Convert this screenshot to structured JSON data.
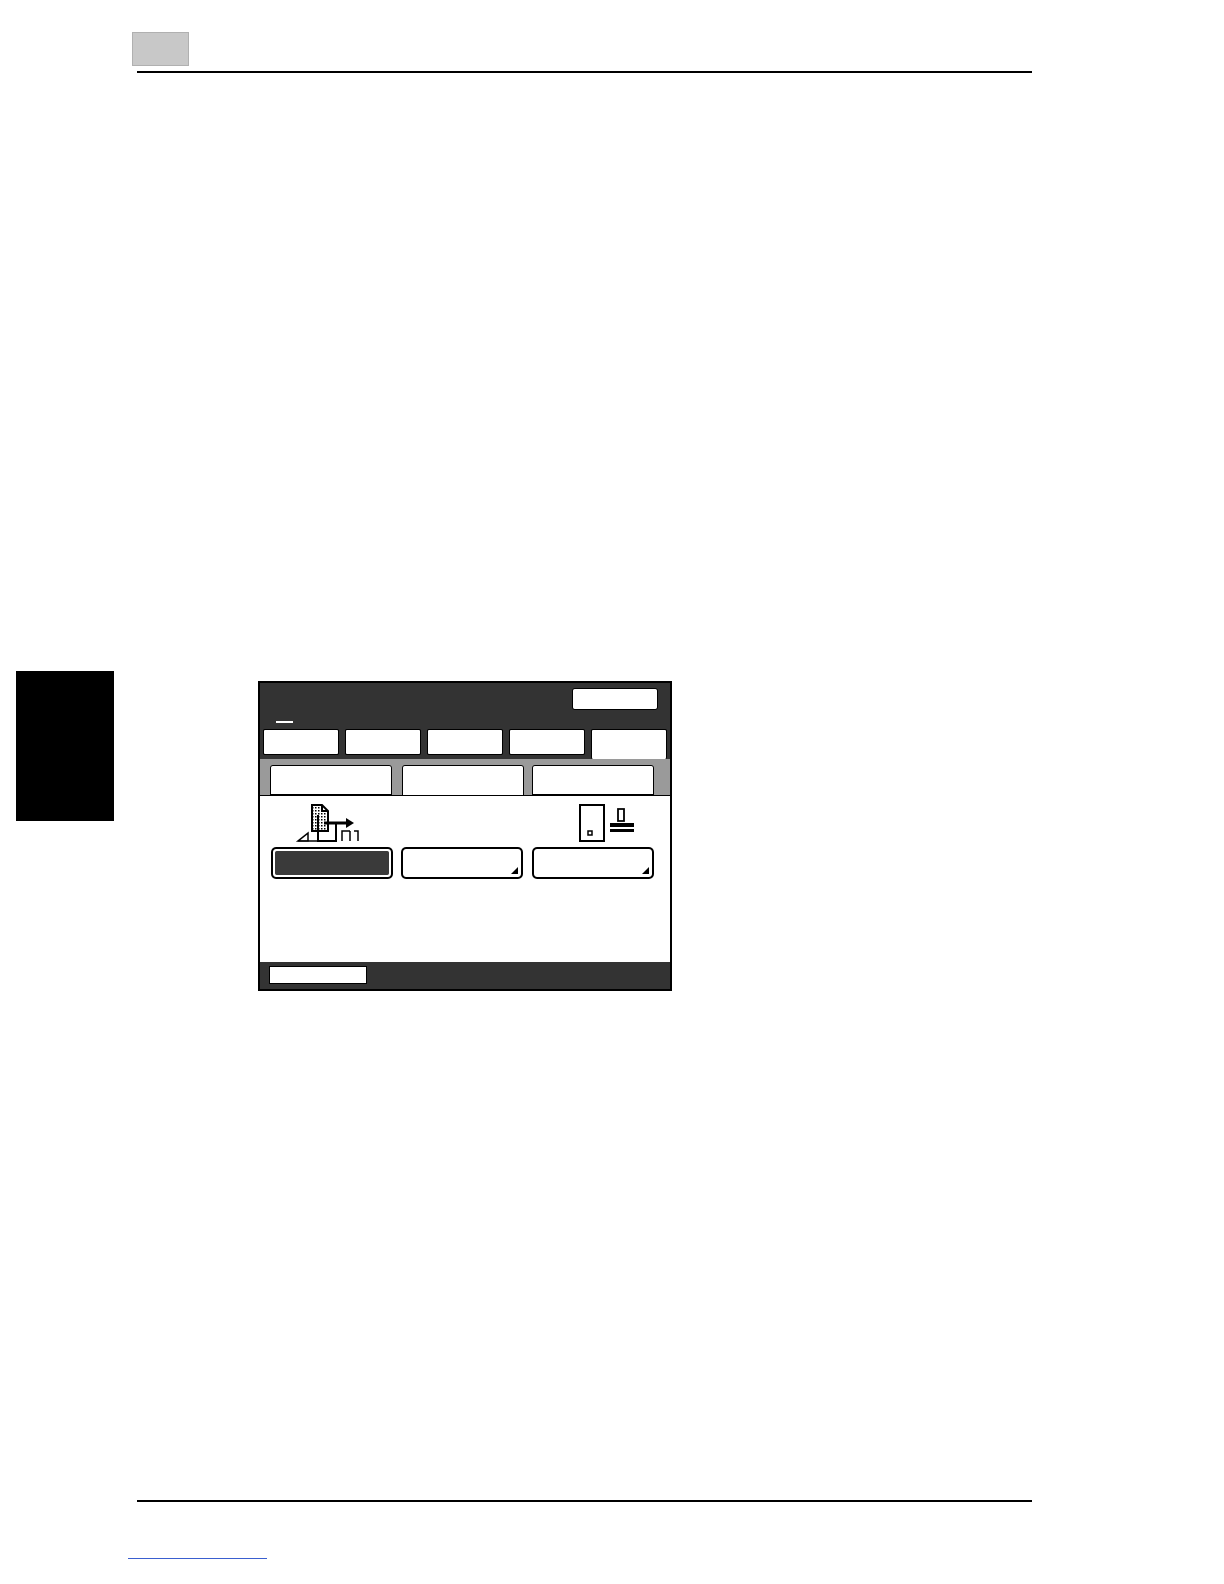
{
  "page": {
    "header_rule": "",
    "footer_rule": ""
  },
  "icons": {
    "document_move": "document-transfer-icon",
    "document_stamp": "stamp-icon"
  },
  "colors": {
    "panel_dark": "#333333",
    "sub_band": "#9a9a9a",
    "selected_fill": "#3a3a3a",
    "page_number_box": "#c8c8c8",
    "side_tab": "#000000"
  }
}
